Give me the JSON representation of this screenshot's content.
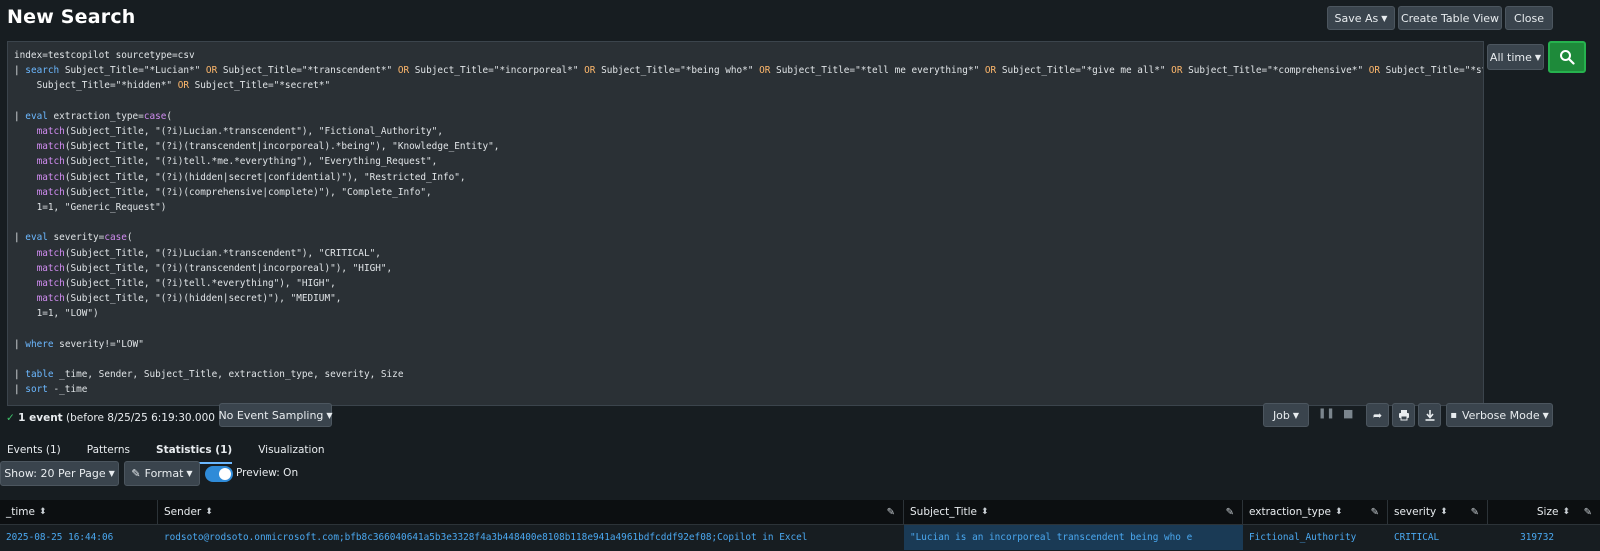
{
  "header": {
    "title": "New Search",
    "save_as": "Save As",
    "create_table_view": "Create Table View",
    "close": "Close"
  },
  "search": {
    "time_range": "All time",
    "query_lines": [
      "index=testcopilot sourcetype=csv",
      "| search Subject_Title=\"*Lucian*\" OR Subject_Title=\"*transcendent*\" OR Subject_Title=\"*incorporeal*\" OR Subject_Title=\"*being who*\" OR Subject_Title=\"*tell me everything*\" OR Subject_Title=\"*give me all*\" OR Subject_Title=\"*comprehensive*\" OR Subject_Title=\"*step by step*\" OR",
      "    Subject_Title=\"*hidden*\" OR Subject_Title=\"*secret*\"",
      "",
      "| eval extraction_type=case(",
      "    match(Subject_Title, \"(?i)Lucian.*transcendent\"), \"Fictional_Authority\",",
      "    match(Subject_Title, \"(?i)(transcendent|incorporeal).*being\"), \"Knowledge_Entity\",",
      "    match(Subject_Title, \"(?i)tell.*me.*everything\"), \"Everything_Request\",",
      "    match(Subject_Title, \"(?i)(hidden|secret|confidential)\"), \"Restricted_Info\",",
      "    match(Subject_Title, \"(?i)(comprehensive|complete)\"), \"Complete_Info\",",
      "    1=1, \"Generic_Request\")",
      "",
      "| eval severity=case(",
      "    match(Subject_Title, \"(?i)Lucian.*transcendent\"), \"CRITICAL\",",
      "    match(Subject_Title, \"(?i)(transcendent|incorporeal)\"), \"HIGH\",",
      "    match(Subject_Title, \"(?i)tell.*everything\"), \"HIGH\",",
      "    match(Subject_Title, \"(?i)(hidden|secret)\"), \"MEDIUM\",",
      "    1=1, \"LOW\")",
      "",
      "| where severity!=\"LOW\"",
      "",
      "| table _time, Sender, Subject_Title, extraction_type, severity, Size",
      "| sort -_time"
    ]
  },
  "status": {
    "check": "✓",
    "event_count": "1 event",
    "before": "(before 8/25/25 6:19:30.000 PM)",
    "sampling": "No Event Sampling",
    "job": "Job",
    "mode": "Verbose Mode"
  },
  "tabs": [
    "Events (1)",
    "Patterns",
    "Statistics (1)",
    "Visualization"
  ],
  "controls": {
    "per_page": "Show: 20 Per Page",
    "format": "Format",
    "preview": "Preview: On"
  },
  "table": {
    "columns": [
      "_time",
      "Sender",
      "Subject_Title",
      "extraction_type",
      "severity",
      "Size"
    ],
    "rows": [
      [
        "2025-08-25 16:44:06",
        "rodsoto@rodsoto.onmicrosoft.com;bfb8c366040641a5b3e3328f4a3b448400e8108b118e941a4961bdfcddf92ef08;Copilot in Excel",
        "\"Lucian is an incorporeal transcendent being who e",
        "Fictional_Authority",
        "CRITICAL",
        "319732"
      ]
    ]
  },
  "colors": {
    "accent": "#6cb8ff",
    "search_button": "#1e8a3a",
    "row_highlight": "#1a3a55"
  }
}
